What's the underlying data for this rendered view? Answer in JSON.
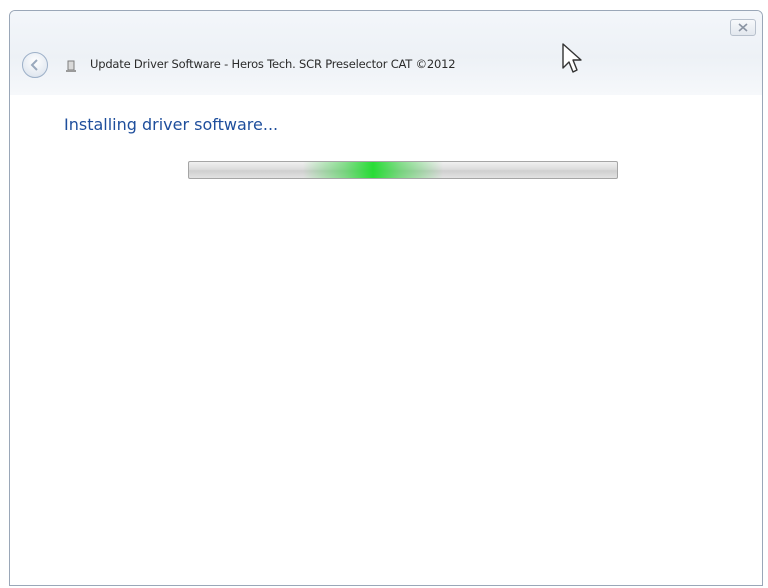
{
  "window": {
    "title": "Update Driver Software - Heros Tech. SCR Preselector CAT ©2012",
    "icons": {
      "back": "back-arrow-icon",
      "device": "device-icon",
      "close": "close-icon",
      "cursor": "mouse-cursor-icon"
    }
  },
  "content": {
    "heading": "Installing driver software..."
  },
  "progress": {
    "style": "indeterminate-marquee",
    "glow_position": 0.43,
    "glow_color": "#1edc2d"
  },
  "colors": {
    "heading": "#1e4e9c",
    "titlebar": "#edf1f6"
  }
}
